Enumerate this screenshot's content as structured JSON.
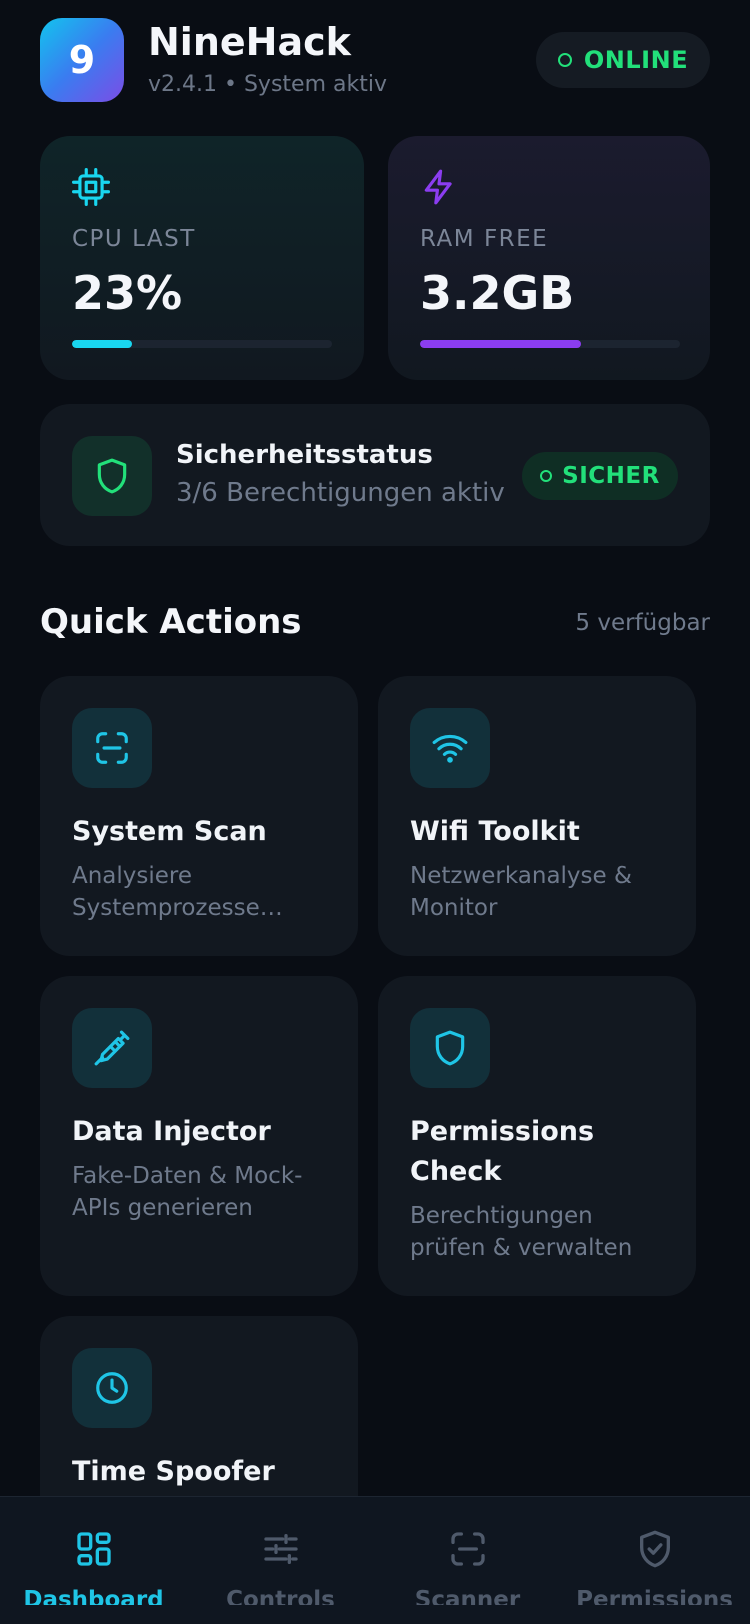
{
  "header": {
    "app_icon_text": "9",
    "app_name": "NineHack",
    "version_status": "v2.4.1 • System aktiv",
    "online_label": "ONLINE"
  },
  "stats": {
    "cpu": {
      "label": "CPU LAST",
      "value": "23%",
      "fill_percent": 23,
      "icon": "chip-icon",
      "color": "#19d6ef"
    },
    "ram": {
      "label": "RAM FREE",
      "value": "3.2GB",
      "fill_percent": 62,
      "icon": "lightning-icon",
      "color": "#8b3df0"
    }
  },
  "security": {
    "title": "Sicherheitsstatus",
    "subtitle": "3/6 Berechtigungen aktiv",
    "badge": "SICHER",
    "icon": "shield-icon",
    "color": "#22e07a"
  },
  "quick_actions": {
    "title": "Quick Actions",
    "count_label": "5 verfügbar",
    "items": [
      {
        "title": "System Scan",
        "desc": "Analysiere Systemprozesse und…",
        "icon": "scan-icon"
      },
      {
        "title": "Wifi Toolkit",
        "desc": "Netzwerkanalyse & Monitor",
        "icon": "wifi-icon"
      },
      {
        "title": "Data Injector",
        "desc": "Fake-Daten & Mock-APIs generieren",
        "icon": "syringe-icon"
      },
      {
        "title": "Permissions Check",
        "desc": "Berechtigungen prüfen & verwalten",
        "icon": "shield-icon"
      },
      {
        "title": "Time Spoofer",
        "desc": "",
        "icon": "clock-icon"
      }
    ]
  },
  "nav": {
    "items": [
      {
        "label": "Dashboard",
        "icon": "dashboard-grid-icon",
        "active": true
      },
      {
        "label": "Controls",
        "icon": "sliders-icon",
        "active": false
      },
      {
        "label": "Scanner",
        "icon": "scan-icon",
        "active": false
      },
      {
        "label": "Permissions",
        "icon": "shield-check-icon",
        "active": false
      }
    ]
  },
  "colors": {
    "accent_cyan": "#1fc5e6",
    "accent_purple": "#8b3df0",
    "status_green": "#22e07a",
    "background": "#090d14",
    "card": "#121820"
  }
}
